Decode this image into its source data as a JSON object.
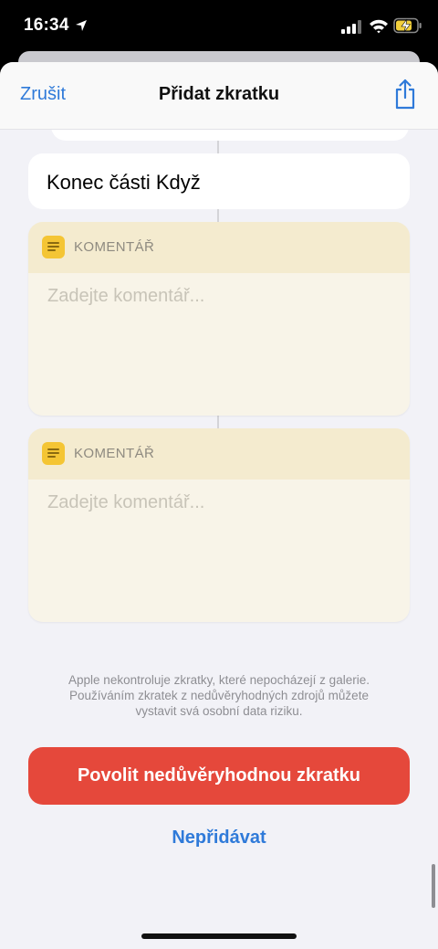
{
  "status": {
    "time": "16:34"
  },
  "nav": {
    "cancel_label": "Zrušit",
    "title": "Přidat zkratku"
  },
  "end_block": {
    "label": "Konec části Když"
  },
  "comments": [
    {
      "title": "KOMENTÁŘ",
      "placeholder": "Zadejte komentář..."
    },
    {
      "title": "KOMENTÁŘ",
      "placeholder": "Zadejte komentář..."
    }
  ],
  "disclaimer": {
    "line1": "Apple nekontroluje zkratky, které nepocházejí z galerie.",
    "line2": "Používáním zkratek z nedůvěryhodných zdrojů můžete",
    "line3": "vystavit svá osobní data riziku."
  },
  "actions": {
    "allow_label": "Povolit nedůvěryhodnou zkratku",
    "dont_add_label": "Nepřidávat"
  },
  "colors": {
    "accent": "#2f7ad9",
    "danger": "#e5483b",
    "comment_icon": "#f4c534",
    "comment_bg": "#f8f4e8"
  },
  "icons": [
    "location-arrow-icon",
    "signal-icon",
    "wifi-icon",
    "battery-charging-icon",
    "share-icon",
    "comment-icon"
  ]
}
